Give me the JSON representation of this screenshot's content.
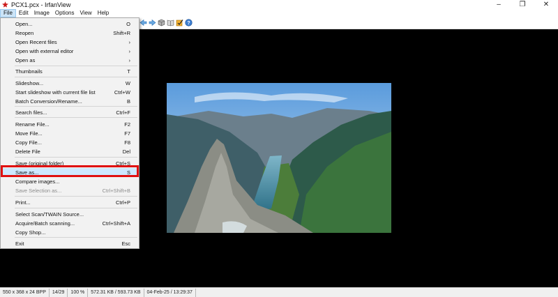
{
  "window": {
    "title": "PCX1.pcx - IrfanView",
    "minimize": "–",
    "maximize": "❐",
    "close": "✕"
  },
  "menubar": [
    "File",
    "Edit",
    "Image",
    "Options",
    "View",
    "Help"
  ],
  "file_menu": [
    {
      "label": "Open...",
      "shortcut": "O"
    },
    {
      "label": "Reopen",
      "shortcut": "Shift+R"
    },
    {
      "label": "Open Recent files",
      "shortcut": "›"
    },
    {
      "label": "Open with external editor",
      "shortcut": "›"
    },
    {
      "label": "Open as",
      "shortcut": "›"
    },
    {
      "label": "Thumbnails",
      "shortcut": "T"
    },
    {
      "label": "Slideshow...",
      "shortcut": "W"
    },
    {
      "label": "Start slideshow with current file list",
      "shortcut": "Ctrl+W"
    },
    {
      "label": "Batch Conversion/Rename...",
      "shortcut": "B"
    },
    {
      "label": "Search files...",
      "shortcut": "Ctrl+F"
    },
    {
      "label": "Rename File...",
      "shortcut": "F2"
    },
    {
      "label": "Move File...",
      "shortcut": "F7"
    },
    {
      "label": "Copy File...",
      "shortcut": "F8"
    },
    {
      "label": "Delete File",
      "shortcut": "Del"
    },
    {
      "label": "Save (original folder)",
      "shortcut": "Ctrl+S"
    },
    {
      "label": "Save as...",
      "shortcut": "S"
    },
    {
      "label": "Compare images...",
      "shortcut": ""
    },
    {
      "label": "Save Selection as...",
      "shortcut": "Ctrl+Shift+B"
    },
    {
      "label": "Print...",
      "shortcut": "Ctrl+P"
    },
    {
      "label": "Select Scan/TWAIN Source...",
      "shortcut": ""
    },
    {
      "label": "Acquire/Batch scanning...",
      "shortcut": "Ctrl+Shift+A"
    },
    {
      "label": "Copy Shop...",
      "shortcut": ""
    },
    {
      "label": "Exit",
      "shortcut": "Esc"
    }
  ],
  "toolbar_icons": [
    "prev-arrow-icon",
    "next-arrow-icon",
    "cube-icon",
    "book-icon",
    "checkbox-icon",
    "help-icon"
  ],
  "statusbar": [
    "550 x 368 x 24 BPP",
    "14/29",
    "100 %",
    "572.31 KB / 593.73 KB",
    "04-Feb-25 / 13:29:37"
  ],
  "colors": {
    "highlight_box": "#e01010",
    "menu_active": "#cce4f7",
    "canvas": "#000000"
  }
}
